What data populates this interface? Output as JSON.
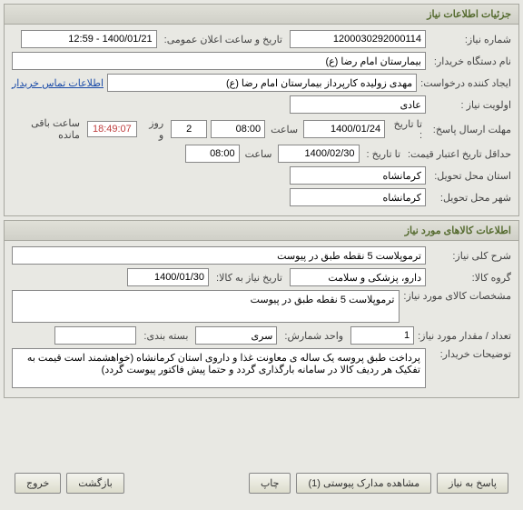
{
  "info_panel": {
    "title": "جزئیات اطلاعات نیاز",
    "need_number_label": "شماره نیاز:",
    "need_number": "1200030292000114",
    "announce_label": "تاریخ و ساعت اعلان عمومی:",
    "announce_value": "1400/01/21 - 12:59",
    "buyer_org_label": "نام دستگاه خریدار:",
    "buyer_org": "بیمارستان امام رضا (ع)",
    "creator_label": "ایجاد کننده درخواست:",
    "creator": "مهدی زولیده کارپرداز بیمارستان امام رضا (ع)",
    "contact_link": "اطلاعات تماس خریدار",
    "priority_label": "اولویت نیاز :",
    "priority": "عادی",
    "deadline_label": "مهلت ارسال پاسخ:",
    "to_date_label": "تا تاریخ :",
    "deadline_date": "1400/01/24",
    "time_label": "ساعت",
    "deadline_time": "08:00",
    "days_value": "2",
    "days_label": "روز و",
    "countdown": "18:49:07",
    "remain_label": "ساعت باقی مانده",
    "validity_label": "حداقل تاریخ اعتبار قیمت:",
    "validity_date": "1400/02/30",
    "validity_time": "08:00",
    "province_label": "استان محل تحویل:",
    "province": "کرمانشاه",
    "city_label": "شهر محل تحویل:",
    "city": "کرمانشاه"
  },
  "goods_panel": {
    "title": "اطلاعات کالاهای مورد نیاز",
    "desc_label": "شرح کلی نیاز:",
    "desc": "ترموپلاست 5 نقطه طبق در پیوست",
    "group_label": "گروه کالا:",
    "group": "دارو، پزشکی و سلامت",
    "history_label": "تاریخ نیاز به کالا:",
    "history_value": "1400/01/30",
    "specs_label": "مشخصات کالای مورد نیاز:",
    "specs": "ترموپلاست 5 نقطه طبق در پیوست",
    "qty_label": "تعداد / مقدار مورد نیاز:",
    "qty": "1",
    "unit_label": "واحد شمارش:",
    "unit": "سری",
    "pack_label": "بسته بندی:",
    "pack": "",
    "notes_label": "توضیحات خریدار:",
    "notes": "پرداخت طبق پروسه یک ساله ی معاونت غذا و داروی استان کرمانشاه (خواهشمند است قیمت به تفکیک هر ردیف کالا در سامانه بارگذاری گردد و حتما پیش فاکتور پیوست گردد)"
  },
  "buttons": {
    "respond": "پاسخ به نیاز",
    "attachments": "مشاهده مدارک پیوستی  (1)",
    "print": "چاپ",
    "back": "بازگشت",
    "exit": "خروج"
  }
}
